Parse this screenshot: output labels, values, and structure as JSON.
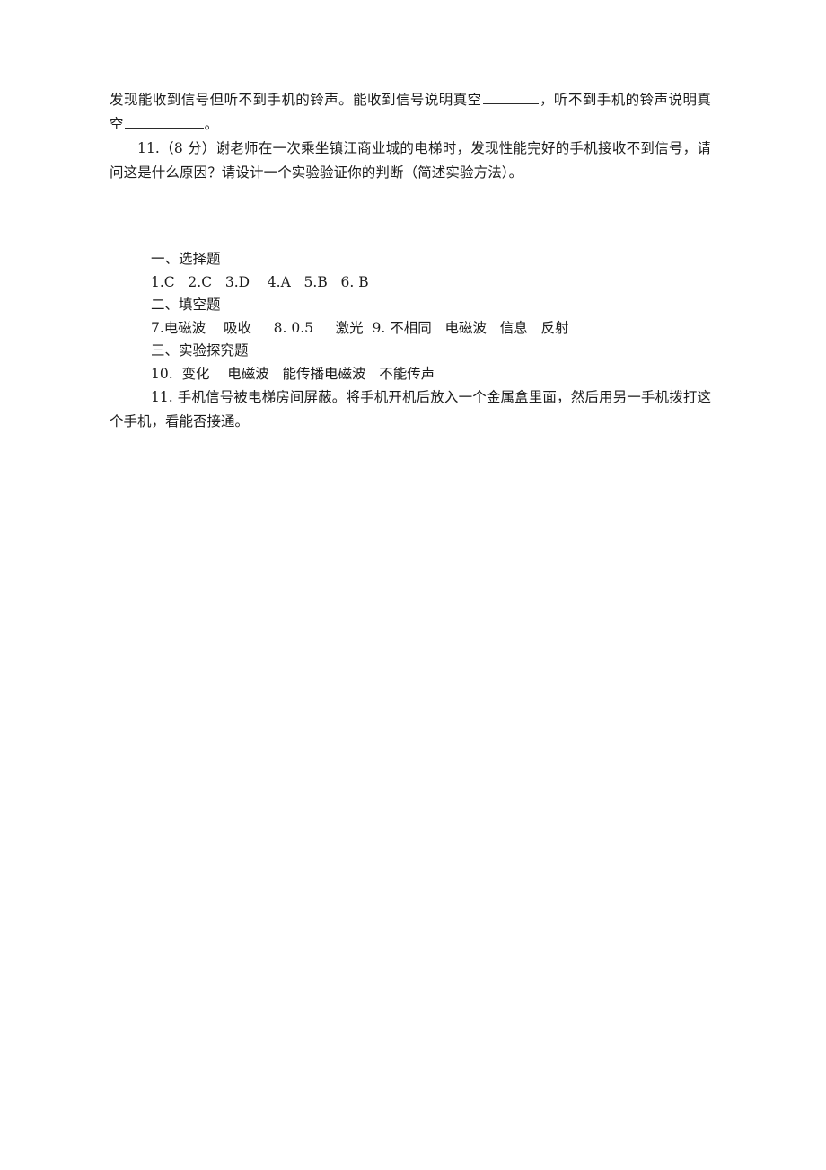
{
  "document": {
    "language": "zh-CN",
    "page_background": "#ffffff",
    "text_color": "#1c1c1c",
    "questions": {
      "q10_tail": {
        "segment_1": "发现能收到信号但听不到手机的铃声。能收到信号说明真空",
        "segment_2": "，听不到手机的铃声说明真空",
        "segment_3": "。"
      },
      "q11": {
        "text": "11.（8 分）谢老师在一次乘坐镇江商业城的电梯时，发现性能完好的手机接收不到信号，请问这是什么原因？请设计一个实验验证你的判断（简述实验方法）。"
      }
    },
    "answer_key": {
      "section_1_heading": "一、选择题",
      "section_1_answers": "1.C   2.C   3.D    4.A   5.B   6. B",
      "section_2_heading": "二、填空题",
      "section_2_answers": "7.电磁波    吸收     8. 0.5     激光  9. 不相同   电磁波   信息   反射",
      "section_3_heading": "三、实验探究题",
      "section_3_answer_10": "10.  变化    电磁波   能传播电磁波   不能传声",
      "section_3_answer_11": "11. 手机信号被电梯房间屏蔽。将手机开机后放入一个金属盒里面，然后用另一手机拨打这个手机，看能否接通。"
    }
  }
}
